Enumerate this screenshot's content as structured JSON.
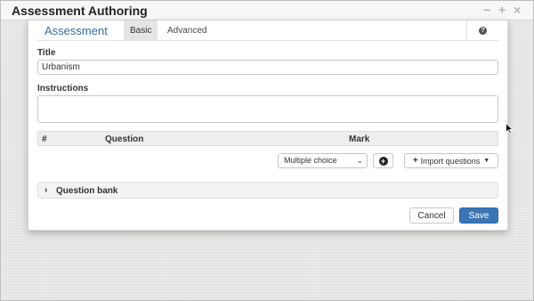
{
  "window": {
    "title": "Assessment Authoring",
    "controls": {
      "minimize": "−",
      "maximize": "+",
      "close": "×"
    }
  },
  "tabs": {
    "heading": "Assessment",
    "items": [
      {
        "label": "Basic",
        "active": true
      },
      {
        "label": "Advanced",
        "active": false
      }
    ],
    "help_icon": "question-circle-icon"
  },
  "form": {
    "title_label": "Title",
    "title_value": "Urbanism",
    "instructions_label": "Instructions",
    "instructions_value": ""
  },
  "questions_table": {
    "columns": [
      "#",
      "Question",
      "Mark"
    ]
  },
  "question_controls": {
    "type_select": {
      "selected": "Multiple choice",
      "icon": "chevron-down-icon"
    },
    "add_icon": "plus-circle-icon",
    "import_label": "Import questions",
    "import_icon": "plus-icon"
  },
  "question_bank": {
    "label": "Question bank",
    "icon": "chevron-right-icon"
  },
  "actions": {
    "cancel_label": "Cancel",
    "save_label": "Save"
  },
  "colors": {
    "accent": "#3a76b5",
    "heading": "#2f6ea5"
  }
}
